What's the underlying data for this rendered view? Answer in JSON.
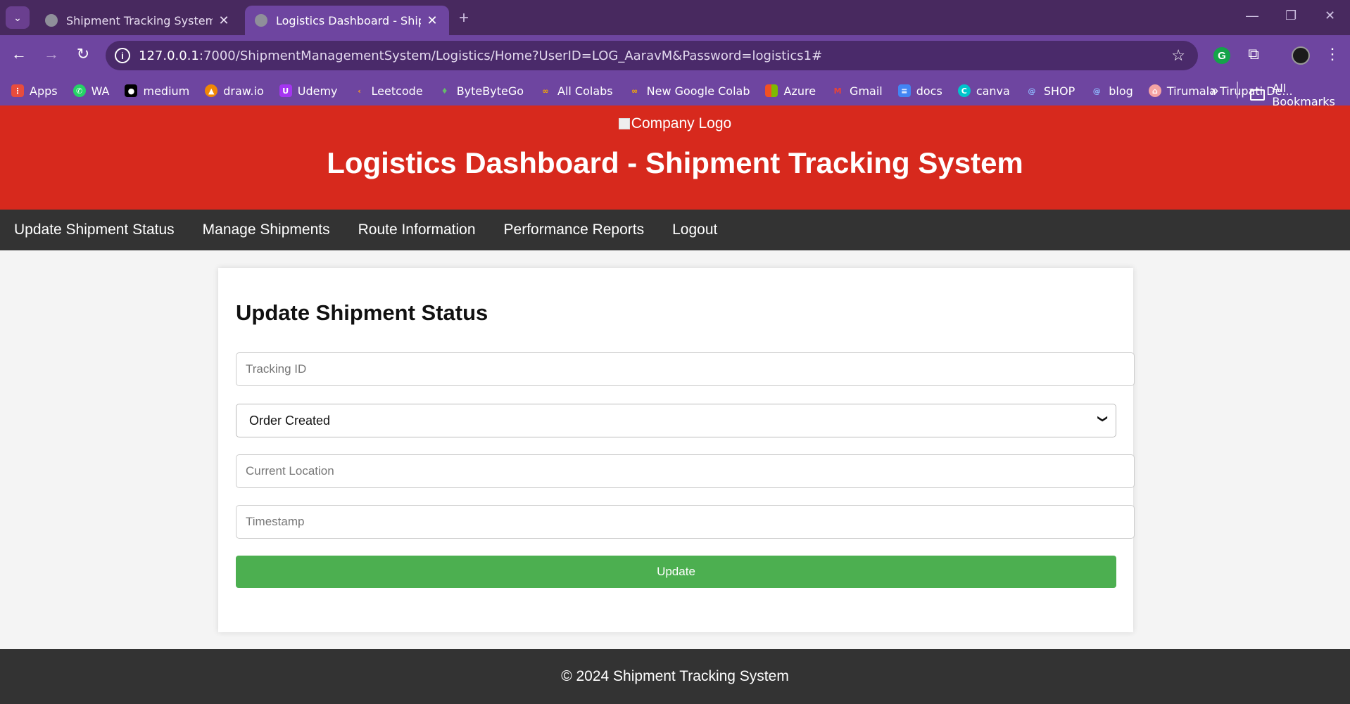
{
  "browser": {
    "tabs": [
      {
        "title": "Shipment Tracking System",
        "active": false
      },
      {
        "title": "Logistics Dashboard - Shipment Tracking System",
        "active": true
      }
    ],
    "url_host": "127.0.0.1",
    "url_path": ":7000/ShipmentManagementSystem/Logistics/Home?UserID=LOG_AaravM&Password=logistics1#",
    "bookmarks": [
      {
        "label": "Apps",
        "icon": "apps-grid-icon",
        "color": "#e84c3d"
      },
      {
        "label": "WA",
        "icon": "whatsapp-icon",
        "color": "#25d366"
      },
      {
        "label": "medium",
        "icon": "medium-icon",
        "color": "#000000"
      },
      {
        "label": "draw.io",
        "icon": "drawio-icon",
        "color": "#f08705"
      },
      {
        "label": "Udemy",
        "icon": "udemy-icon",
        "color": "#a435f0"
      },
      {
        "label": "Leetcode",
        "icon": "leetcode-icon",
        "color": "#ffa116"
      },
      {
        "label": "ByteByteGo",
        "icon": "bytebytego-icon",
        "color": "#2e7d32"
      },
      {
        "label": "All Colabs",
        "icon": "colab-icon",
        "color": "#f9ab00"
      },
      {
        "label": "New Google Colab",
        "icon": "colab-icon",
        "color": "#f9ab00"
      },
      {
        "label": "Azure",
        "icon": "azure-icon",
        "color": "#0078d4"
      },
      {
        "label": "Gmail",
        "icon": "gmail-icon",
        "color": "#ea4335"
      },
      {
        "label": "docs",
        "icon": "docs-icon",
        "color": "#4285f4"
      },
      {
        "label": "canva",
        "icon": "canva-icon",
        "color": "#00c4cc"
      },
      {
        "label": "SHOP",
        "icon": "spiral-icon",
        "color": "#4a90e2"
      },
      {
        "label": "blog",
        "icon": "spiral-icon",
        "color": "#4a90e2"
      },
      {
        "label": "Tirumala Tirupati De...",
        "icon": "temple-icon",
        "color": "#f5a3a3"
      }
    ],
    "all_bookmarks": "All Bookmarks"
  },
  "header": {
    "logo_alt": "Company Logo",
    "title": "Logistics Dashboard - Shipment Tracking System",
    "bg_color": "#d7291d"
  },
  "nav": {
    "items": [
      "Update Shipment Status",
      "Manage Shipments",
      "Route Information",
      "Performance Reports",
      "Logout"
    ]
  },
  "form": {
    "heading": "Update Shipment Status",
    "tracking_placeholder": "Tracking ID",
    "status_selected": "Order Created",
    "location_placeholder": "Current Location",
    "timestamp_placeholder": "Timestamp",
    "submit_label": "Update",
    "submit_color": "#4caf50"
  },
  "footer": {
    "text": "© 2024 Shipment Tracking System"
  }
}
